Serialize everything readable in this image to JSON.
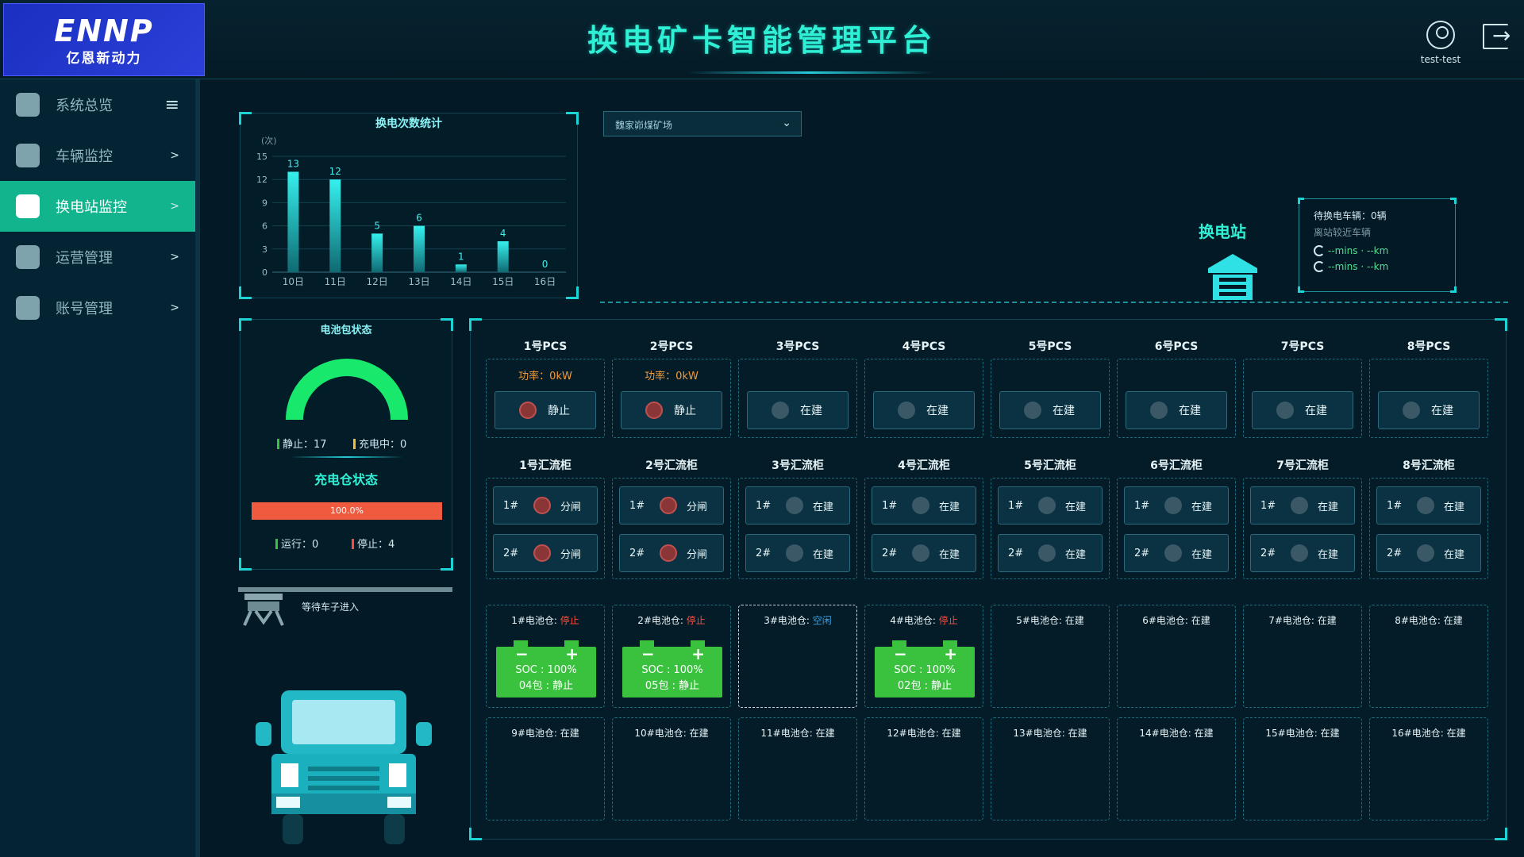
{
  "header": {
    "logo_mark": "ENNP",
    "logo_sub": "亿恩新动力",
    "title": "换电矿卡智能管理平台",
    "username": "test-test"
  },
  "sidebar": {
    "items": [
      {
        "label": "系统总览",
        "icon": "location-person-icon",
        "active": false
      },
      {
        "label": "车辆监控",
        "icon": "bus-icon",
        "active": false
      },
      {
        "label": "换电站监控",
        "icon": "home-up-icon",
        "active": true
      },
      {
        "label": "运营管理",
        "icon": "pie-chart-icon",
        "active": false
      },
      {
        "label": "账号管理",
        "icon": "user-gear-icon",
        "active": false
      }
    ]
  },
  "swap_chart": {
    "title": "换电次数统计"
  },
  "chart_data": {
    "type": "bar",
    "title": "换电次数统计",
    "ylabel": "(次)",
    "categories": [
      "10日",
      "11日",
      "12日",
      "13日",
      "14日",
      "15日",
      "16日"
    ],
    "values": [
      13,
      12,
      5,
      6,
      1,
      4,
      0
    ],
    "ylim": [
      0,
      15
    ],
    "yticks": [
      0,
      3,
      6,
      9,
      12,
      15
    ],
    "grid": true,
    "colors": {
      "bar_top": "#35f0ee",
      "bar_bottom": "#0f6a72"
    }
  },
  "site_select": {
    "value": "魏家峁煤矿场"
  },
  "station": {
    "label": "换电站",
    "waiting_label": "待换电车辆：",
    "waiting_value": "0辆",
    "nearest_label": "离站较近车辆",
    "eta": [
      "--mins · --km",
      "--mins · --km"
    ]
  },
  "battery_pack": {
    "title": "电池包状态",
    "idle_label": "静止：",
    "idle_value": "17",
    "charging_label": "充电中：",
    "charging_value": "0",
    "gauge_fraction": 1.0,
    "charge_bay_title": "充电仓状态",
    "progress_text": "100.0%",
    "progress_fraction": 1.0,
    "running_label": "运行：",
    "running_value": "0",
    "stopped_label": "停止：",
    "stopped_value": "4"
  },
  "waiting_text": "等待车子进入",
  "pcs": [
    {
      "name": "1号PCS",
      "power": "功率：0kW",
      "status": "静止",
      "red": true
    },
    {
      "name": "2号PCS",
      "power": "功率：0kW",
      "status": "静止",
      "red": true
    },
    {
      "name": "3号PCS",
      "power": "",
      "status": "在建",
      "red": false
    },
    {
      "name": "4号PCS",
      "power": "",
      "status": "在建",
      "red": false
    },
    {
      "name": "5号PCS",
      "power": "",
      "status": "在建",
      "red": false
    },
    {
      "name": "6号PCS",
      "power": "",
      "status": "在建",
      "red": false
    },
    {
      "name": "7号PCS",
      "power": "",
      "status": "在建",
      "red": false
    },
    {
      "name": "8号PCS",
      "power": "",
      "status": "在建",
      "red": false
    }
  ],
  "combiners": [
    {
      "name": "1号汇流柜",
      "a": "分闸",
      "b": "分闸",
      "red": true
    },
    {
      "name": "2号汇流柜",
      "a": "分闸",
      "b": "分闸",
      "red": true
    },
    {
      "name": "3号汇流柜",
      "a": "在建",
      "b": "在建",
      "red": false
    },
    {
      "name": "4号汇流柜",
      "a": "在建",
      "b": "在建",
      "red": false
    },
    {
      "name": "5号汇流柜",
      "a": "在建",
      "b": "在建",
      "red": false
    },
    {
      "name": "6号汇流柜",
      "a": "在建",
      "b": "在建",
      "red": false
    },
    {
      "name": "7号汇流柜",
      "a": "在建",
      "b": "在建",
      "red": false
    },
    {
      "name": "8号汇流柜",
      "a": "在建",
      "b": "在建",
      "red": false
    }
  ],
  "combiner_slot_labels": [
    "1#",
    "2#"
  ],
  "bays": [
    {
      "label": "1#电池仓: ",
      "status": "停止",
      "kind": "stop",
      "soc": "SOC : 100%",
      "pack": "04包 : 静止"
    },
    {
      "label": "2#电池仓: ",
      "status": "停止",
      "kind": "stop",
      "soc": "SOC : 100%",
      "pack": "05包 : 静止"
    },
    {
      "label": "3#电池仓: ",
      "status": "空闲",
      "kind": "idle",
      "soc": "",
      "pack": ""
    },
    {
      "label": "4#电池仓: ",
      "status": "停止",
      "kind": "stop",
      "soc": "SOC : 100%",
      "pack": "02包 : 静止"
    },
    {
      "label": "5#电池仓: ",
      "status": "在建",
      "kind": "build",
      "soc": "",
      "pack": ""
    },
    {
      "label": "6#电池仓: ",
      "status": "在建",
      "kind": "build",
      "soc": "",
      "pack": ""
    },
    {
      "label": "7#电池仓: ",
      "status": "在建",
      "kind": "build",
      "soc": "",
      "pack": ""
    },
    {
      "label": "8#电池仓: ",
      "status": "在建",
      "kind": "build",
      "soc": "",
      "pack": ""
    },
    {
      "label": "9#电池仓: ",
      "status": "在建",
      "kind": "build",
      "soc": "",
      "pack": ""
    },
    {
      "label": "10#电池仓: ",
      "status": "在建",
      "kind": "build",
      "soc": "",
      "pack": ""
    },
    {
      "label": "11#电池仓: ",
      "status": "在建",
      "kind": "build",
      "soc": "",
      "pack": ""
    },
    {
      "label": "12#电池仓: ",
      "status": "在建",
      "kind": "build",
      "soc": "",
      "pack": ""
    },
    {
      "label": "13#电池仓: ",
      "status": "在建",
      "kind": "build",
      "soc": "",
      "pack": ""
    },
    {
      "label": "14#电池仓: ",
      "status": "在建",
      "kind": "build",
      "soc": "",
      "pack": ""
    },
    {
      "label": "15#电池仓: ",
      "status": "在建",
      "kind": "build",
      "soc": "",
      "pack": ""
    },
    {
      "label": "16#电池仓: ",
      "status": "在建",
      "kind": "build",
      "soc": "",
      "pack": ""
    }
  ],
  "colors": {
    "accent": "#2ff0d4",
    "menu_active": "#11b48c",
    "green": "#3ac23f",
    "red": "#ff4b3b",
    "orange": "#f29b3a"
  }
}
